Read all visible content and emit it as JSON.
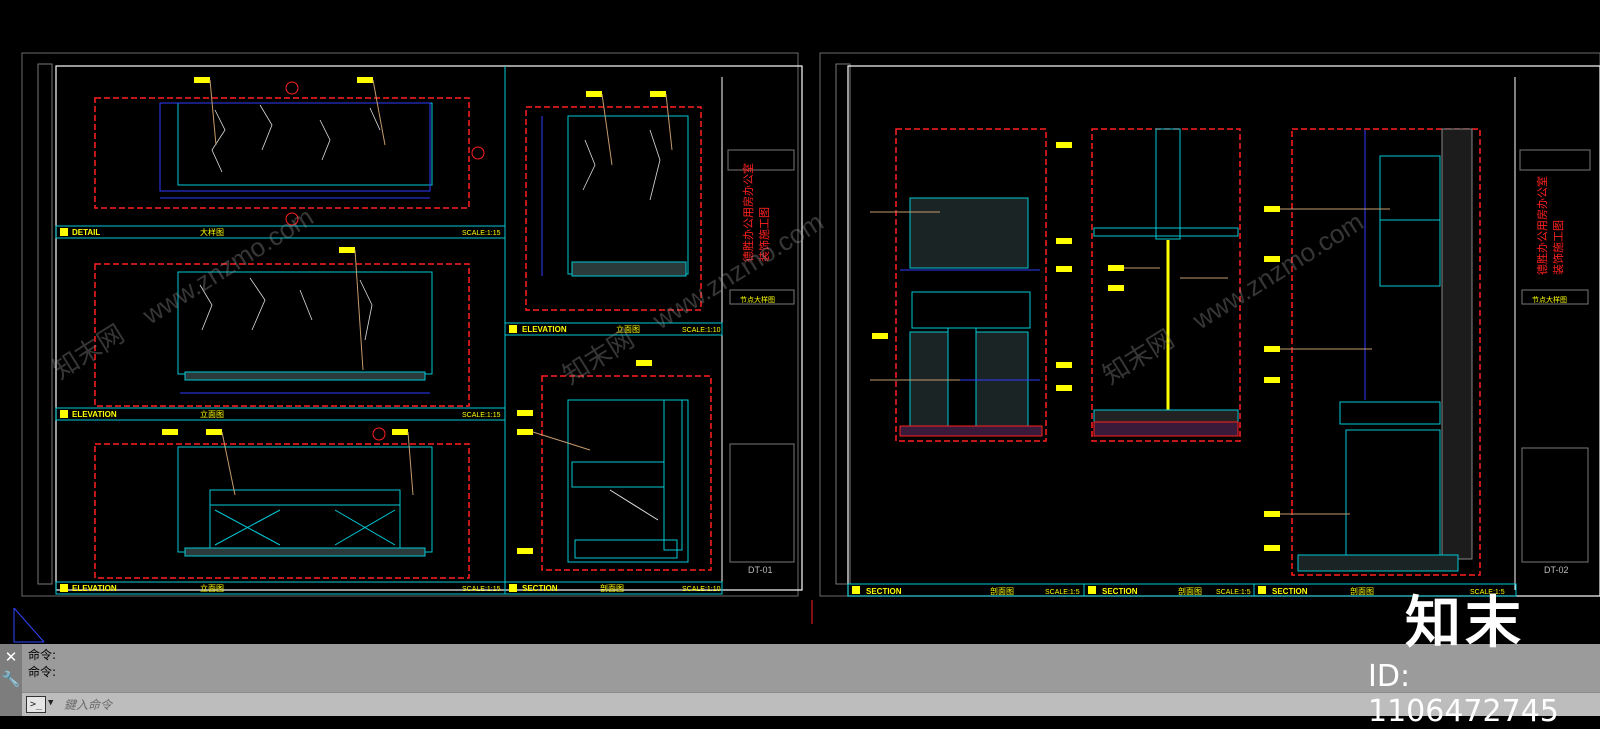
{
  "drawing": {
    "sheet1": {
      "views": [
        {
          "tag": "DETAIL",
          "title": "大样图",
          "scale": "SCALE:1:15"
        },
        {
          "tag": "ELEVATION",
          "title": "立面图",
          "scale": "SCALE:1:15"
        },
        {
          "tag": "ELEVATION",
          "title": "立面图",
          "scale": "SCALE:1:15"
        },
        {
          "tag": "ELEVATION",
          "title": "立面图",
          "scale": "SCALE:1:10"
        },
        {
          "tag": "SECTION",
          "title": "剖面图",
          "scale": "SCALE:1:10"
        }
      ],
      "title_block": {
        "project": "德胜办公用房办公室",
        "type": "装饰施工图",
        "drawing": "节点大样图",
        "number": "DT-01"
      }
    },
    "sheet2": {
      "views": [
        {
          "tag": "SECTION",
          "title": "剖面图",
          "scale": "SCALE:1:5"
        },
        {
          "tag": "SECTION",
          "title": "剖面图",
          "scale": "SCALE:1:5"
        },
        {
          "tag": "SECTION",
          "title": "剖面图",
          "scale": "SCALE:1:5"
        }
      ],
      "title_block": {
        "project": "德胜办公用房办公室",
        "type": "装饰施工图",
        "drawing": "节点大样图",
        "number": "DT-02"
      }
    },
    "watermark_site": "www.znzmo.com",
    "watermark_cn": "知末网"
  },
  "command_line": {
    "history": [
      "命令:",
      "命令:"
    ],
    "placeholder": "鍵入命令",
    "prompt_glyph": ">_"
  },
  "watermark": {
    "brand": "知末",
    "id": "ID: 1106472745"
  },
  "colors": {
    "background": "#000000",
    "frame": "#ffffff",
    "cyan": "#00c8d6",
    "red": "#ff2020",
    "blue": "#2f3cff",
    "yellow": "#ffff00",
    "tan": "#c49a6c",
    "command_bg": "#9b9b9b"
  }
}
